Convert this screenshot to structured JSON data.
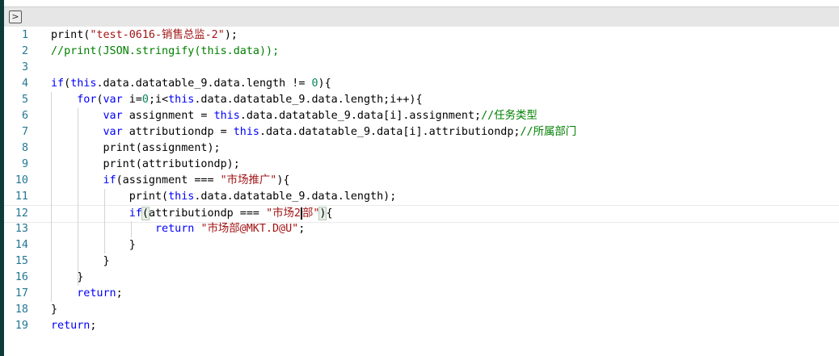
{
  "toolbar": {
    "run_icon": "chevron-right-icon"
  },
  "editor": {
    "current_line": 12,
    "lines": [
      [
        [
          "p",
          "print("
        ],
        [
          "s",
          "\"test-0616-销售总监-2\""
        ],
        [
          "p",
          ");"
        ]
      ],
      [
        [
          "c",
          "//print(JSON.stringify(this.data));"
        ]
      ],
      [],
      [
        [
          "k",
          "if"
        ],
        [
          "p",
          "("
        ],
        [
          "k",
          "this"
        ],
        [
          "p",
          ".data.datatable_9.data.length != "
        ],
        [
          "n",
          "0"
        ],
        [
          "p",
          "){"
        ]
      ],
      [
        [
          "p",
          "    "
        ],
        [
          "k",
          "for"
        ],
        [
          "p",
          "("
        ],
        [
          "k",
          "var"
        ],
        [
          "p",
          " i="
        ],
        [
          "n",
          "0"
        ],
        [
          "p",
          ";i<"
        ],
        [
          "k",
          "this"
        ],
        [
          "p",
          ".data.datatable_9.data.length;i++){"
        ]
      ],
      [
        [
          "p",
          "        "
        ],
        [
          "k",
          "var"
        ],
        [
          "p",
          " assignment = "
        ],
        [
          "k",
          "this"
        ],
        [
          "p",
          ".data.datatable_9.data[i].assignment;"
        ],
        [
          "c",
          "//任务类型"
        ]
      ],
      [
        [
          "p",
          "        "
        ],
        [
          "k",
          "var"
        ],
        [
          "p",
          " attributiondp = "
        ],
        [
          "k",
          "this"
        ],
        [
          "p",
          ".data.datatable_9.data[i].attributiondp;"
        ],
        [
          "c",
          "//所属部门"
        ]
      ],
      [
        [
          "p",
          "        print(assignment);"
        ]
      ],
      [
        [
          "p",
          "        print(attributiondp);"
        ]
      ],
      [
        [
          "p",
          "        "
        ],
        [
          "k",
          "if"
        ],
        [
          "p",
          "(assignment === "
        ],
        [
          "s",
          "\"市场推广\""
        ],
        [
          "p",
          "){"
        ]
      ],
      [
        [
          "p",
          "            print("
        ],
        [
          "k",
          "this"
        ],
        [
          "p",
          ".data.datatable_9.data.length);"
        ]
      ],
      [
        [
          "p",
          "            "
        ],
        [
          "k",
          "if"
        ],
        [
          "b",
          "("
        ],
        [
          "p",
          "attributiondp === "
        ],
        [
          "s",
          "\"市场2"
        ],
        [
          "caret",
          ""
        ],
        [
          "s",
          "部\""
        ],
        [
          "b",
          ")"
        ],
        [
          "p",
          "{"
        ]
      ],
      [
        [
          "p",
          "                "
        ],
        [
          "k",
          "return"
        ],
        [
          "p",
          " "
        ],
        [
          "s",
          "\"市场部@MKT.D@U\""
        ],
        [
          "p",
          ";"
        ]
      ],
      [
        [
          "p",
          "            }"
        ]
      ],
      [
        [
          "p",
          "        }"
        ]
      ],
      [
        [
          "p",
          "    }"
        ]
      ],
      [
        [
          "p",
          "    "
        ],
        [
          "k",
          "return"
        ],
        [
          "p",
          ";"
        ]
      ],
      [
        [
          "p",
          "}"
        ]
      ],
      [
        [
          "k",
          "return"
        ],
        [
          "p",
          ";"
        ]
      ]
    ]
  }
}
